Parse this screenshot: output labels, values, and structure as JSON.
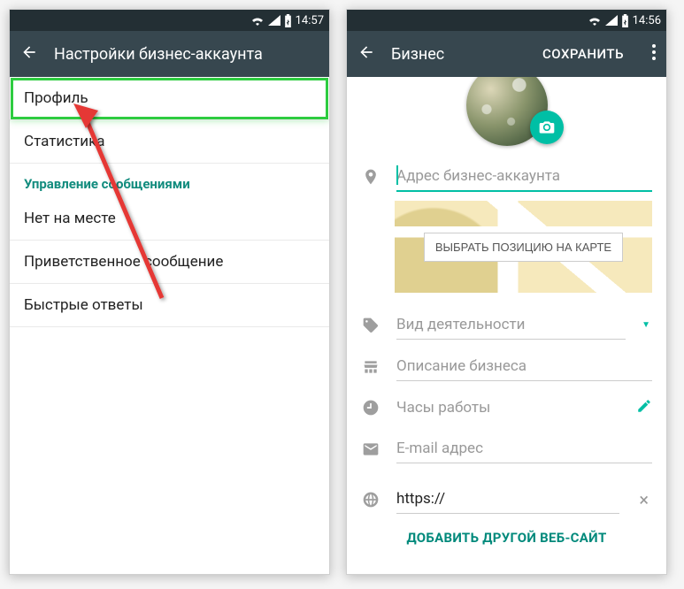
{
  "left": {
    "statusbar": {
      "time": "14:57"
    },
    "appbar": {
      "title": "Настройки бизнес-аккаунта"
    },
    "items": {
      "profile": "Профиль",
      "stats": "Статистика",
      "section_messaging": "Управление сообщениями",
      "away": "Нет на месте",
      "greeting": "Приветственное сообщение",
      "quick": "Быстрые ответы"
    }
  },
  "right": {
    "statusbar": {
      "time": "14:56"
    },
    "appbar": {
      "title": "Бизнес",
      "save": "СОХРАНИТЬ"
    },
    "fields": {
      "address_placeholder": "Адрес бизнес-аккаунта",
      "map_button": "ВЫБРАТЬ ПОЗИЦИЮ НА КАРТЕ",
      "category_placeholder": "Вид деятельности",
      "description_placeholder": "Описание бизнеса",
      "hours_placeholder": "Часы работы",
      "email_placeholder": "E-mail адрес",
      "website_value": "https://",
      "add_website": "ДОБАВИТЬ ДРУГОЙ ВЕБ-САЙТ"
    }
  }
}
